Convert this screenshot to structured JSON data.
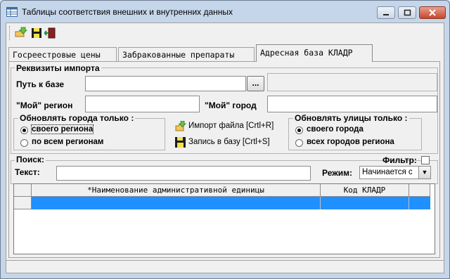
{
  "window": {
    "title": "Таблицы соответствия внешних и внутренних данных",
    "minimize_icon": "minimize-icon",
    "maximize_icon": "maximize-icon",
    "close_icon": "close-icon"
  },
  "toolbar": {
    "icons": [
      "import-folder-icon",
      "save-floppy-icon",
      "exit-door-icon"
    ]
  },
  "tabs": [
    {
      "label": "Госреестровые цены",
      "active": false
    },
    {
      "label": "Забракованные препараты",
      "active": false
    },
    {
      "label": "Адресная база КЛАДР",
      "active": true
    }
  ],
  "import": {
    "group_label": "Реквизиты импорта",
    "path_label": "Путь к базе",
    "path_value": "",
    "browse_label": "...",
    "my_region_label": "\"Мой\" регион",
    "my_region_value": "",
    "my_city_label": "\"Мой\" город",
    "my_city_value": ""
  },
  "cities_update": {
    "label": "Обновлять города только :",
    "options": [
      {
        "label": "своего региона",
        "selected": true
      },
      {
        "label": "по всем регионам",
        "selected": false
      }
    ]
  },
  "actions": {
    "import_label": "Импорт файла [Crtl+R]",
    "save_label": "Запись в базу [Crtl+S]"
  },
  "streets_update": {
    "label": "Обновлять улицы только :",
    "options": [
      {
        "label": "своего города",
        "selected": true
      },
      {
        "label": "всех городов региона",
        "selected": false
      }
    ]
  },
  "search": {
    "group_label": "Поиск:",
    "text_label": "Текст:",
    "text_value": "",
    "filter_label": "Фильтр:",
    "filter_checked": false,
    "mode_label": "Режим:",
    "mode_value": "Начинается с"
  },
  "grid": {
    "columns": [
      "*Наименование административной единицы",
      "Код КЛАДР"
    ],
    "rows": [
      {
        "name": "",
        "code": "",
        "selected": true
      }
    ]
  },
  "colors": {
    "selection": "#1e90ff",
    "window_frame": "#c6d6ea",
    "client": "#f0f0f0"
  }
}
